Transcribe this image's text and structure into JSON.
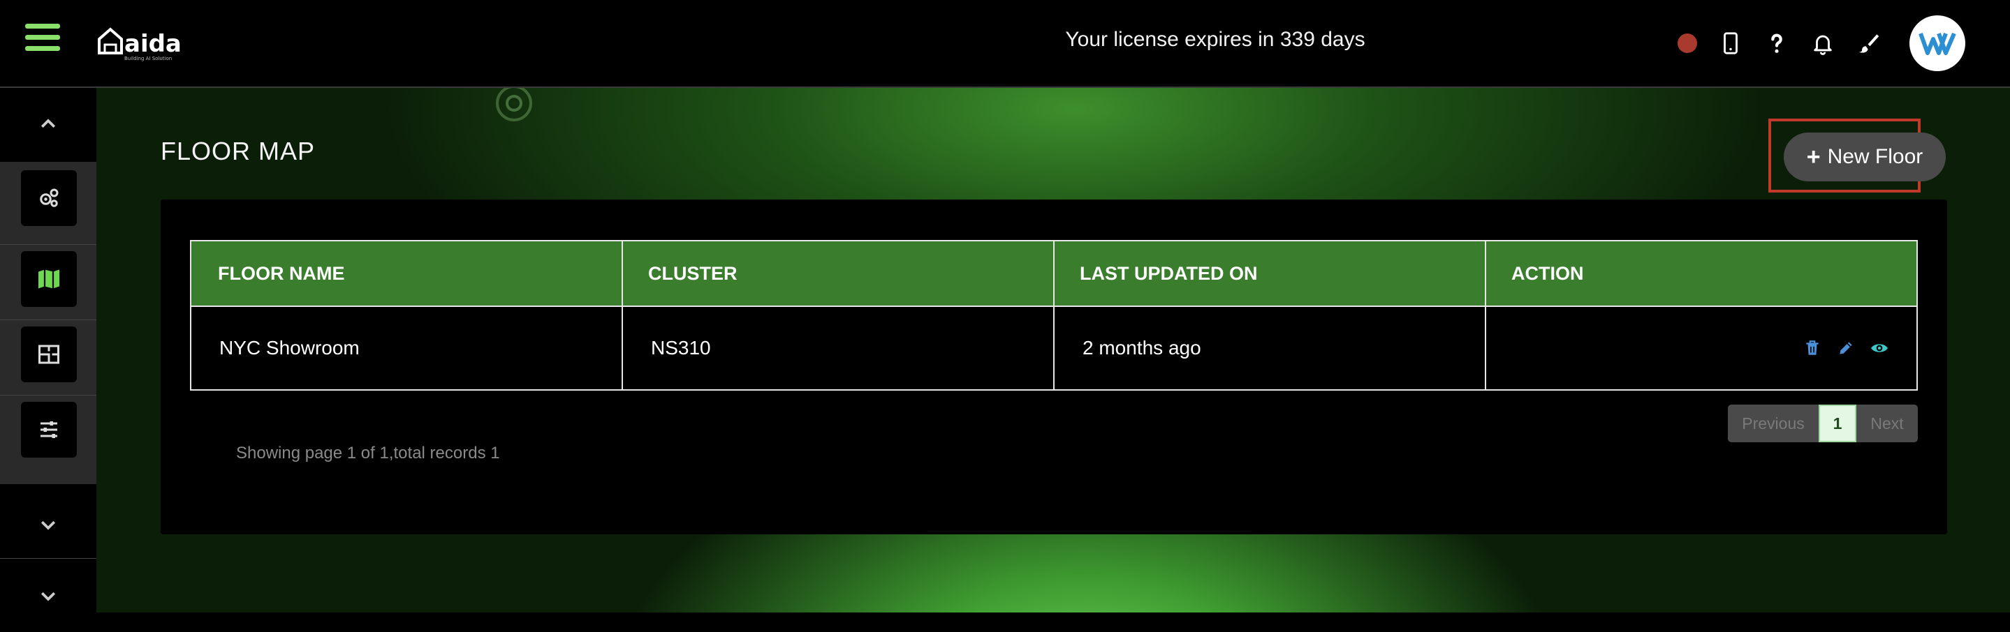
{
  "header": {
    "brand": "aida",
    "tagline": "Building AI Solution",
    "license_text": "Your license expires in 339 days",
    "icons": [
      "status-dot",
      "phone-icon",
      "help-icon",
      "bell-icon",
      "brush-icon",
      "avatar"
    ]
  },
  "sidebar": {
    "items": [
      {
        "icon": "gears-icon"
      },
      {
        "icon": "map-icon"
      },
      {
        "icon": "floorplan-icon"
      },
      {
        "icon": "sliders-icon"
      }
    ]
  },
  "main": {
    "title": "FLOOR MAP",
    "new_button": "New Floor",
    "table": {
      "columns": [
        "FLOOR NAME",
        "CLUSTER",
        "LAST UPDATED ON",
        "ACTION"
      ],
      "rows": [
        {
          "floor_name": "NYC Showroom",
          "cluster": "NS310",
          "updated": "2 months ago"
        }
      ]
    },
    "pagination": {
      "previous": "Previous",
      "current": "1",
      "next": "Next",
      "summary": "Showing page 1 of 1,total records 1"
    }
  },
  "colors": {
    "accent_green": "#3a7d2d",
    "highlight_red": "#c0392b",
    "status_red": "#a83a2e",
    "icon_blue": "#4a90d9",
    "icon_teal": "#3cc9c9"
  }
}
